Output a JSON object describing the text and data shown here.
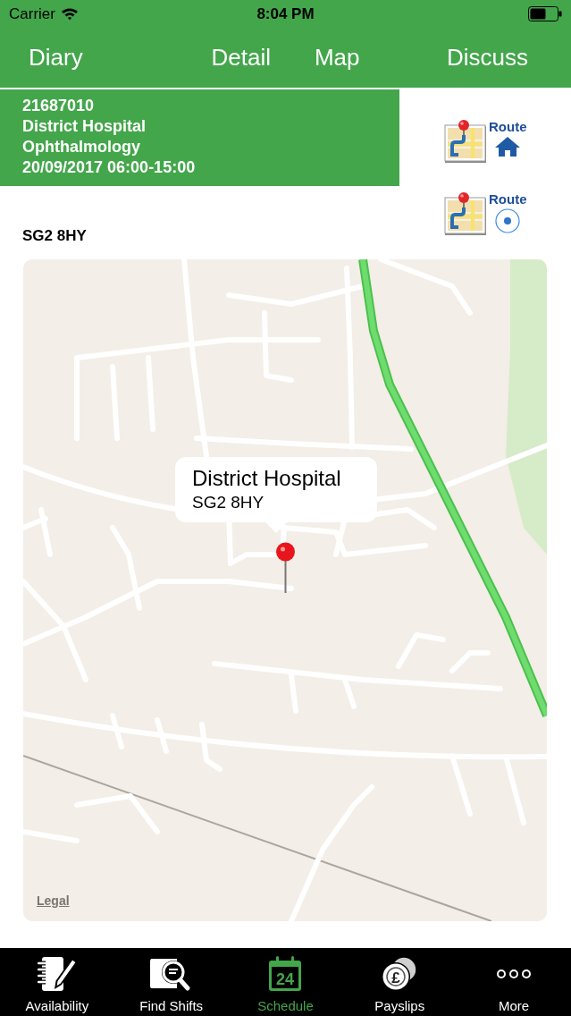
{
  "status_bar": {
    "carrier": "Carrier",
    "time": "8:04 PM"
  },
  "nav_tabs": [
    {
      "label": "Diary"
    },
    {
      "label": "Detail"
    },
    {
      "label": "Map"
    },
    {
      "label": "Discuss"
    }
  ],
  "shift": {
    "id": "21687010",
    "location": "District Hospital",
    "department": "Ophthalmology",
    "datetime": "20/09/2017 06:00-15:00"
  },
  "route_buttons": [
    {
      "kind": "home",
      "label": "Route"
    },
    {
      "kind": "location",
      "label": "Route"
    }
  ],
  "postcode": "SG2 8HY",
  "map": {
    "callout": {
      "title": "District Hospital",
      "subtitle": "SG2 8HY"
    },
    "legal_link": "Legal"
  },
  "tab_bar": [
    {
      "kind": "availability",
      "label": "Availability",
      "selected": false
    },
    {
      "kind": "find_shifts",
      "label": "Find Shifts",
      "selected": false
    },
    {
      "kind": "schedule",
      "label": "Schedule",
      "icon_text": "24",
      "selected": true
    },
    {
      "kind": "payslips",
      "label": "Payslips",
      "icon_text": "£",
      "selected": false
    },
    {
      "kind": "more",
      "label": "More",
      "selected": false
    }
  ]
}
